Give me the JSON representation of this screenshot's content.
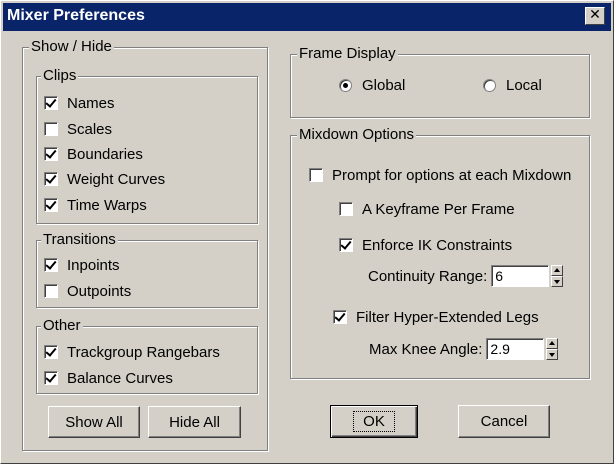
{
  "window": {
    "title": "Mixer Preferences",
    "close_icon": "✕"
  },
  "show_hide": {
    "label": "Show / Hide",
    "clips": {
      "label": "Clips",
      "items": [
        {
          "label": "Names",
          "checked": true
        },
        {
          "label": "Scales",
          "checked": false
        },
        {
          "label": "Boundaries",
          "checked": true
        },
        {
          "label": "Weight Curves",
          "checked": true
        },
        {
          "label": "Time Warps",
          "checked": true
        }
      ]
    },
    "transitions": {
      "label": "Transitions",
      "items": [
        {
          "label": "Inpoints",
          "checked": true
        },
        {
          "label": "Outpoints",
          "checked": false
        }
      ]
    },
    "other": {
      "label": "Other",
      "items": [
        {
          "label": "Trackgroup Rangebars",
          "checked": true
        },
        {
          "label": "Balance Curves",
          "checked": true
        }
      ]
    },
    "show_all_label": "Show All",
    "hide_all_label": "Hide All"
  },
  "frame_display": {
    "label": "Frame Display",
    "options": [
      {
        "label": "Global",
        "selected": true
      },
      {
        "label": "Local",
        "selected": false
      }
    ]
  },
  "mixdown": {
    "label": "Mixdown Options",
    "prompt": {
      "label": "Prompt for options at each Mixdown",
      "checked": false
    },
    "keyframe": {
      "label": "A Keyframe Per Frame",
      "checked": false
    },
    "enforce_ik": {
      "label": "Enforce IK Constraints",
      "checked": true
    },
    "continuity_label": "Continuity Range:",
    "continuity_value": "6",
    "filter_legs": {
      "label": "Filter Hyper-Extended Legs",
      "checked": true
    },
    "knee_label": "Max Knee Angle:",
    "knee_value": "2.9"
  },
  "buttons": {
    "ok": "OK",
    "cancel": "Cancel"
  },
  "colors": {
    "titlebar": "#0a246a",
    "face": "#d4d0c8"
  }
}
